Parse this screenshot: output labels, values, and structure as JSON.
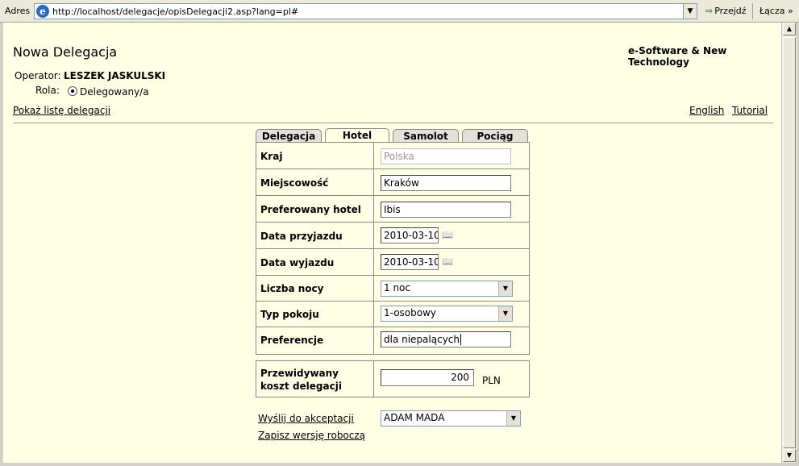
{
  "browser": {
    "address_label": "Adres",
    "url": "http://localhost/delegacje/opisDelegacji2.asp?lang=pl#",
    "go_label": "Przejdź",
    "links_label": "Łącza",
    "links_chevron": "»"
  },
  "header": {
    "title": "Nowa Delegacja",
    "company": "e-Software & New Technology",
    "operator_label": "Operator:",
    "operator_name": "LESZEK JASKULSKI",
    "role_label": "Rola:",
    "role_value": "Delegowany/a",
    "show_list_link": "Pokaż listę delegacji",
    "language_link": "English",
    "tutorial_link": "Tutorial"
  },
  "tabs": [
    {
      "label": "Delegacja",
      "active": false
    },
    {
      "label": "Hotel",
      "active": true
    },
    {
      "label": "Samolot",
      "active": false
    },
    {
      "label": "Pociąg",
      "active": false
    }
  ],
  "form": {
    "country": {
      "label": "Kraj",
      "value": "Polska"
    },
    "city": {
      "label": "Miejscowość",
      "value": "Kraków"
    },
    "hotel": {
      "label": "Preferowany hotel",
      "value": "Ibis"
    },
    "arrival": {
      "label": "Data przyjazdu",
      "value": "2010-03-10"
    },
    "departure": {
      "label": "Data wyjazdu",
      "value": "2010-03-10"
    },
    "nights": {
      "label": "Liczba nocy",
      "value": "1 noc"
    },
    "room_type": {
      "label": "Typ pokoju",
      "value": "1-osobowy"
    },
    "preferences": {
      "label": "Preferencje",
      "value": "dla niepalących"
    }
  },
  "cost": {
    "label_line1": "Przewidywany",
    "label_line2": "koszt delegacji",
    "value": "200",
    "currency": "PLN"
  },
  "actions": {
    "send_link": "Wyślij do akceptacji",
    "approver": "ADAM MADA",
    "draft_link": "Zapisz wersję roboczą"
  },
  "icons": {
    "ie_logo": "e",
    "dropdown_arrow": "▼",
    "calendar": "📖",
    "scroll_up": "▲",
    "scroll_down": "▼",
    "go_arrow": "⇨"
  }
}
